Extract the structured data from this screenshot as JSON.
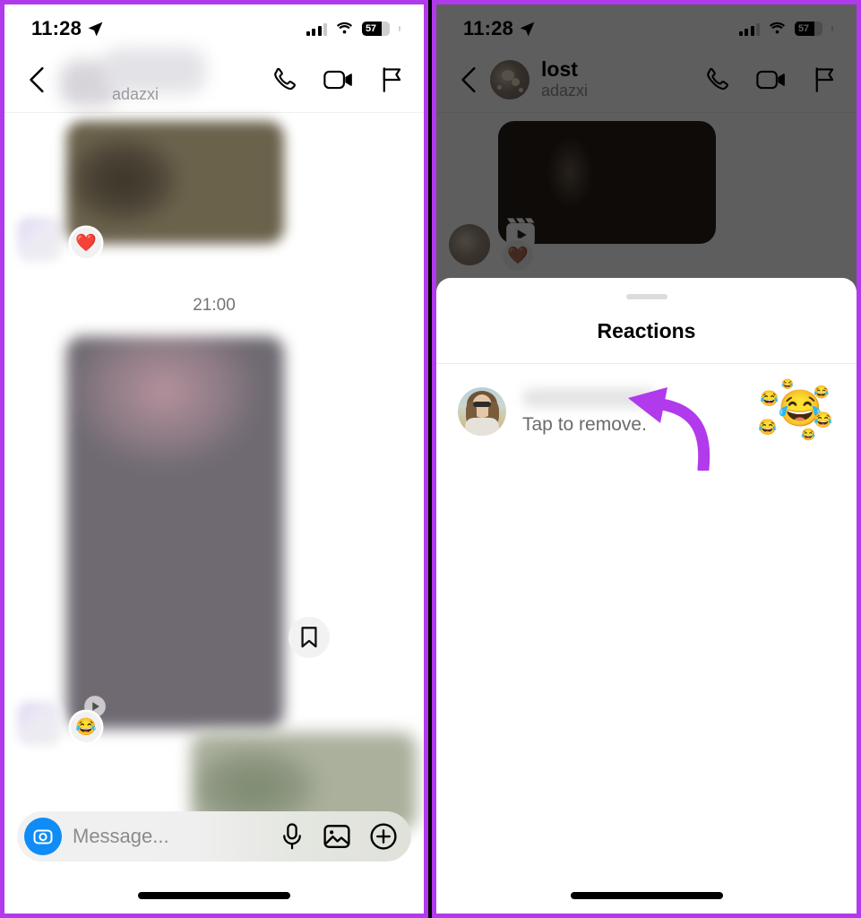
{
  "meta": {
    "app": "Instagram Direct Messages",
    "accent_purple": "#b13aec",
    "accent_blue": "#0f8cf5"
  },
  "status_bar": {
    "time": "11:28",
    "location_icon": "location-arrow-icon",
    "cellular_icon": "cellular-bars-icon",
    "wifi_icon": "wifi-icon",
    "battery_level": "57",
    "battery_icon": "battery-icon"
  },
  "left_panel": {
    "header": {
      "back_icon": "back-chevron-icon",
      "display_name": "",
      "username": "adazxi",
      "call_icon": "phone-call-icon",
      "video_icon": "video-camera-icon",
      "flag_icon": "flag-icon"
    },
    "messages": [
      {
        "type": "photo",
        "reaction": "❤️",
        "reaction_name": "heart-reaction"
      },
      {
        "type": "timestamp",
        "time": "21:00"
      },
      {
        "type": "reel",
        "reaction": "😂",
        "reaction_name": "joy-reaction",
        "save_icon": "bookmark-icon",
        "play_icon": "play-icon"
      },
      {
        "type": "photo-outgoing"
      }
    ],
    "composer": {
      "camera_icon": "camera-icon",
      "placeholder": "Message...",
      "mic_icon": "microphone-icon",
      "gallery_icon": "image-gallery-icon",
      "plus_icon": "plus-circle-icon"
    }
  },
  "right_panel": {
    "header": {
      "back_icon": "back-chevron-icon",
      "display_name": "lost",
      "username": "adazxi",
      "call_icon": "phone-call-icon",
      "video_icon": "video-camera-icon",
      "flag_icon": "flag-icon"
    },
    "message": {
      "type": "reel",
      "reel_icon": "reel-clapperboard-icon",
      "reaction": "🤎",
      "reaction_name": "brown-heart-reaction"
    },
    "sheet": {
      "handle": "drag-handle",
      "title": "Reactions",
      "rows": [
        {
          "avatar": "user-avatar",
          "username": "",
          "subtitle": "Tap to remove.",
          "emoji": "😂",
          "emoji_name": "joy-emoji"
        }
      ]
    }
  },
  "annotation": {
    "arrow_color": "#b13aec",
    "arrow_name": "pointer-arrow"
  }
}
